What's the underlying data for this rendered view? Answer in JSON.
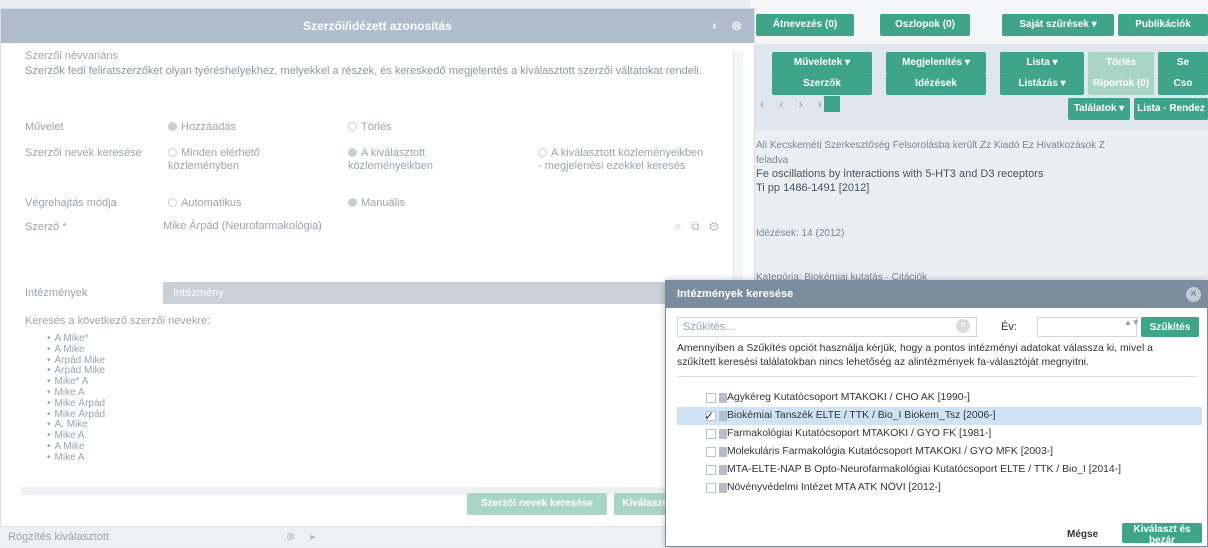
{
  "background": {
    "toolbar_buttons": [
      "Átnevezés (0)",
      "Oszlopok (0)",
      "Saját szűrések ▾",
      "Publikációk"
    ],
    "action_buttons_row1": [
      "Műveletek ▾",
      "Megjelenítés ▾",
      "Lista ▾",
      "Törlés",
      "Se"
    ],
    "action_buttons_row2": [
      "Szerzők",
      "Idézések",
      "Listázás ▾",
      "Riportok (0)",
      "Cso"
    ],
    "pager": "‹ ‹ › ›",
    "page_number": "1",
    "right_buttons": [
      "Találatok ▾",
      "Lista · Rendez"
    ],
    "meta_line": "Ali Kecskeméti Szerkesztőség Felsorolásba került   Zz Kiadó   Ez Hivatkozások   Z",
    "record_lines": [
      "feladva",
      "Fe oscillations by interactions with 5-HT3 and D3 receptors",
      "Ti pp 1486-1491 [2012]"
    ],
    "record_footer": "Idézések: 14 (2012)",
    "record_footer_sub": "Kategória: Biokémiai kutatás · Citációk"
  },
  "main_modal": {
    "title": "Szerzői/idézett azonosítás",
    "header_icons": "◐ ⊗",
    "fieldset_title": "Szerzői névvariáns",
    "intro": "Szerzők fedi feliratszerzőket olyan tyéréshelyekhez, melyekkel a részek, és kereskedő megjelentés a kiválasztott szerzői váltatokat rendeli.",
    "rows": {
      "operation_label": "Művelet",
      "operation_opts": [
        "Hozzáadás",
        "Törlés"
      ],
      "search_label": "Szerzői nevek keresése",
      "search_opts": [
        "Minden elérhető közleményben",
        "A kiválasztott közleményeikben",
        "A kiválasztott közleményeikben - megjelenési ezekkel keresés"
      ],
      "exec_label": "Végrehajtás módja",
      "exec_opts": [
        "Automatikus",
        "Manuális"
      ],
      "author_label": "Szerző *",
      "author_value": "Mike Árpád (Neurofarmakológia)",
      "author_icons": "⌕ ⧉ ⚙",
      "institutions_label": "Intézmények",
      "institutions_value": "Intézmény",
      "inst_icon": "⊗"
    },
    "list_label": "Keresés a következő szerzői nevekre:",
    "names": [
      "A Mike*",
      "A Mike",
      "Árpád Mike",
      "Árpád Mike",
      "Mike* A",
      "Mike A",
      "Mike Árpád",
      "Mike Árpád",
      "A. Mike",
      "Mike A.",
      "A Mike",
      "Mike A"
    ],
    "footer_buttons": [
      "Szerzői nevek keresése",
      "Kiválaszt"
    ],
    "status_text": "Rögzítés kiválasztott",
    "status_icons": "⊗ ▸"
  },
  "dialog": {
    "title": "Intézmények keresése",
    "close_icon": "×",
    "search_placeholder": "Szűkítés...",
    "clear_icon": "×",
    "year_label": "Év:",
    "year_value": "",
    "spinner_icon": "▲▼",
    "narrow_button": "Szűkítés",
    "notice_lines": [
      "Amennyiben a Szűkítés opciót használja kérjük, hogy a pontos intézményi adatokat válassza ki, mivel a",
      "szűkített keresési találatokban nincs lehetőség az alintézmények fa-választóját megnyitni."
    ],
    "items": [
      {
        "label": "Agykéreg Kutatócsoport MTAKOKI / CHO AK [1990-]",
        "checked": false
      },
      {
        "label": "Biokémiai Tanszék ELTE / TTK / Bio_I Biokem_Tsz [2006-]",
        "checked": true
      },
      {
        "label": "Farmakológiai Kutatócsoport MTAKOKI / GYO FK [1981-]",
        "checked": false
      },
      {
        "label": "Molekuláris Farmakológia Kutatócsoport MTAKOKI / GYO MFK [2003-]",
        "checked": false
      },
      {
        "label": "MTA-ELTE-NAP B Opto-Neurofarmakológiai Kutatócsoport ELTE / TTK / Bio_I [2014-]",
        "checked": false
      },
      {
        "label": "Növényvédelmi Intézet MTA ATK NÖVI [2012-]",
        "checked": false
      }
    ],
    "cancel_button": "Mégse",
    "ok_button": "Kiválaszt és bezár"
  },
  "colors": {
    "accent": "#3fa58a",
    "dialog_header": "#7b8c9f",
    "selected_row": "#cfe3f6"
  }
}
